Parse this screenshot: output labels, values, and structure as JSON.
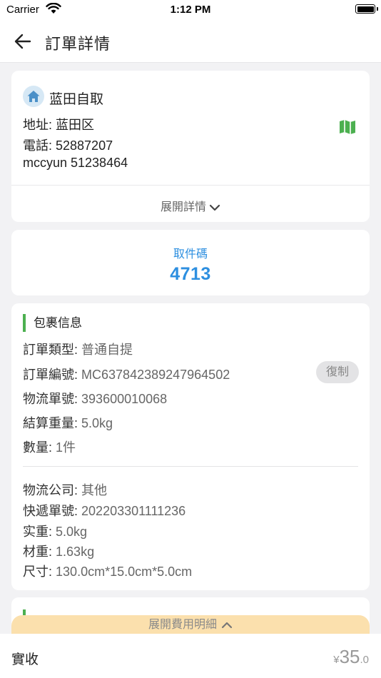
{
  "status_bar": {
    "carrier": "Carrier",
    "time": "1:12 PM"
  },
  "nav": {
    "title": "訂單詳情"
  },
  "pickup": {
    "name": "蓝田自取",
    "address": "地址: 蓝田区",
    "phone": "電話: 52887207",
    "contact": "mccyun 51238464",
    "expand_label": "展開詳情"
  },
  "pickup_code": {
    "label": "取件碼",
    "value": "4713"
  },
  "package": {
    "section_title": "包裹信息",
    "order_type": {
      "key": "訂單類型:",
      "value": "普通自提"
    },
    "order_no": {
      "key": "訂單編號:",
      "value": "MC637842389247964502"
    },
    "copy_label": "復制",
    "logistics_no": {
      "key": "物流單號:",
      "value": "393600010068"
    },
    "settle_weight": {
      "key": "結算重量:",
      "value": "5.0kg"
    },
    "quantity": {
      "key": "數量:",
      "value": "1件"
    },
    "company": {
      "key": "物流公司:",
      "value": "其他"
    },
    "express_no": {
      "key": "快遞單號:",
      "value": "202203301111236"
    },
    "actual_weight": {
      "key": "实重:",
      "value": "5.0kg"
    },
    "volume_weight": {
      "key": "材重:",
      "value": "1.63kg"
    },
    "size": {
      "key": "尺寸:",
      "value": "130.0cm*15.0cm*5.0cm"
    }
  },
  "fee": {
    "expand_label": "展開費用明細"
  },
  "bottom": {
    "label": "實收",
    "currency": "¥",
    "amount_int": "35",
    "amount_dec": ".0"
  },
  "colors": {
    "accent_blue": "#2d8fe0",
    "accent_green": "#4cb050",
    "fee_pill": "#fbe0ad"
  },
  "icons": {
    "back": "arrow-left-icon",
    "home": "home-icon",
    "map": "map-icon",
    "expand": "chevron-down-icon",
    "fee_expand": "chevron-up-icon"
  }
}
